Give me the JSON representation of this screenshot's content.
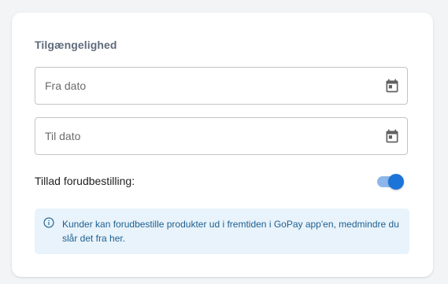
{
  "availability": {
    "title": "Tilgængelighed",
    "from_date": {
      "placeholder": "Fra dato",
      "icon": "calendar-icon"
    },
    "to_date": {
      "placeholder": "Til dato",
      "icon": "calendar-icon"
    },
    "preorder": {
      "label": "Tillad forudbestilling:",
      "enabled": true
    },
    "info": {
      "icon": "info-icon",
      "text": "Kunder kan forudbestille produkter ud i fremtiden i GoPay app'en, medmindre du slår det fra her."
    }
  },
  "colors": {
    "accent": "#1c74d8",
    "toggle_track": "#8db7ea",
    "info_background": "#e8f3fb",
    "info_text": "#1f5f8f"
  }
}
